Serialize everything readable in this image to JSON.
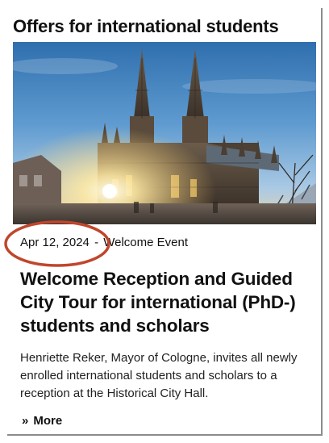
{
  "section": {
    "title": "Offers for international students"
  },
  "hero_image": {
    "subject": "cologne-cathedral-sunset"
  },
  "article": {
    "date": "Apr 12, 2024",
    "separator": "-",
    "category": "Welcome Event",
    "headline": "Welcome Reception and Guided City Tour for international (PhD-) students and scholars",
    "teaser": "Henriette Reker, Mayor of Cologne, invites all newly enrolled international students and scholars to a reception at the Historical City Hall.",
    "more_icon": "»",
    "more_label": "More"
  },
  "colors": {
    "highlight_ring": "#c0462b",
    "text": "#111111",
    "card_border": "#8c8c8c"
  }
}
